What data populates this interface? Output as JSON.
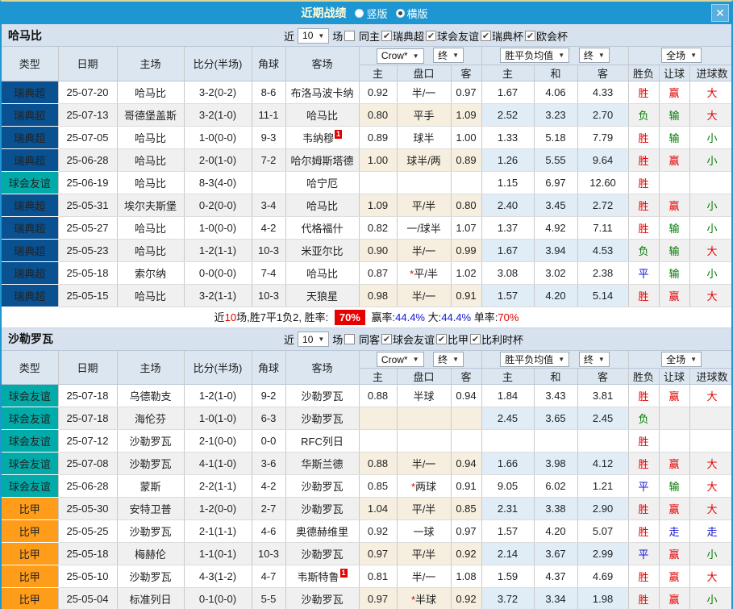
{
  "window": {
    "title": "近期战绩",
    "vertical_label": "竖版",
    "horizontal_label": "横版",
    "close_icon": "✕"
  },
  "columns": {
    "left": [
      "类型",
      "日期",
      "主场",
      "比分(半场)",
      "角球",
      "客场"
    ],
    "sub": [
      "主",
      "盘口",
      "客",
      "主",
      "和",
      "客",
      "胜负",
      "让球",
      "进球数"
    ],
    "dropdowns": {
      "company": "Crow*",
      "final": "终",
      "avg": "胜平负均值",
      "fulltime": "全场"
    }
  },
  "colors": {
    "type": {
      "瑞典超": "#0a5191",
      "球会友谊": "#00aba9",
      "比甲": "#ff9c1a"
    },
    "result": {
      "胜": "#e60000",
      "负": "#007a00",
      "平": "#1414d2",
      "赢": "#e60000",
      "输": "#007a00",
      "走": "#1414d2",
      "大": "#e60000",
      "小": "#007a00"
    }
  },
  "sections": [
    {
      "team": "哈马比",
      "filter": {
        "near_label": "近",
        "count": "10",
        "games_label": "场",
        "same_label": "同主",
        "same_checked": false,
        "leagues": [
          {
            "label": "瑞典超",
            "checked": true
          },
          {
            "label": "球会友谊",
            "checked": true
          },
          {
            "label": "瑞典杯",
            "checked": true
          },
          {
            "label": "欧会杯",
            "checked": true
          }
        ]
      },
      "rows": [
        {
          "type": "瑞典超",
          "date": "25-07-20",
          "home": "哈马比",
          "home_hl": true,
          "score": "3-2(0-2)",
          "corner": "8-6",
          "away": "布洛马波卡纳",
          "away_hl": false,
          "away_badge": "",
          "o1": "0.92",
          "hc": "半/一",
          "o2": "0.97",
          "a1": "1.67",
          "a2": "4.06",
          "a3": "4.33",
          "r1": "胜",
          "r2": "赢",
          "r3": "大"
        },
        {
          "type": "瑞典超",
          "date": "25-07-13",
          "home": "哥德堡盖斯",
          "home_hl": false,
          "score": "3-2(1-0)",
          "corner": "11-1",
          "away": "哈马比",
          "away_hl": true,
          "away_badge": "",
          "o1": "0.80",
          "hc": "平手",
          "o2": "1.09",
          "a1": "2.52",
          "a2": "3.23",
          "a3": "2.70",
          "r1": "负",
          "r2": "输",
          "r3": "大"
        },
        {
          "type": "瑞典超",
          "date": "25-07-05",
          "home": "哈马比",
          "home_hl": true,
          "score": "1-0(0-0)",
          "corner": "9-3",
          "away": "韦纳穆",
          "away_hl": false,
          "away_badge": "1",
          "o1": "0.89",
          "hc": "球半",
          "o2": "1.00",
          "a1": "1.33",
          "a2": "5.18",
          "a3": "7.79",
          "r1": "胜",
          "r2": "输",
          "r3": "小"
        },
        {
          "type": "瑞典超",
          "date": "25-06-28",
          "home": "哈马比",
          "home_hl": true,
          "score": "2-0(1-0)",
          "corner": "7-2",
          "away": "哈尔姆斯塔德",
          "away_hl": false,
          "away_badge": "",
          "o1": "1.00",
          "hc": "球半/两",
          "o2": "0.89",
          "a1": "1.26",
          "a2": "5.55",
          "a3": "9.64",
          "r1": "胜",
          "r2": "赢",
          "r3": "小"
        },
        {
          "type": "球会友谊",
          "date": "25-06-19",
          "home": "哈马比",
          "home_hl": true,
          "score": "8-3(4-0)",
          "corner": "",
          "away": "哈宁厄",
          "away_hl": false,
          "away_badge": "",
          "o1": "",
          "hc": "",
          "o2": "",
          "a1": "1.15",
          "a2": "6.97",
          "a3": "12.60",
          "r1": "胜",
          "r2": "",
          "r3": ""
        },
        {
          "type": "瑞典超",
          "date": "25-05-31",
          "home": "埃尔夫斯堡",
          "home_hl": false,
          "score": "0-2(0-0)",
          "corner": "3-4",
          "away": "哈马比",
          "away_hl": true,
          "away_badge": "",
          "o1": "1.09",
          "hc": "平/半",
          "o2": "0.80",
          "a1": "2.40",
          "a2": "3.45",
          "a3": "2.72",
          "r1": "胜",
          "r2": "赢",
          "r3": "小"
        },
        {
          "type": "瑞典超",
          "date": "25-05-27",
          "home": "哈马比",
          "home_hl": true,
          "score": "1-0(0-0)",
          "corner": "4-2",
          "away": "代格福什",
          "away_hl": false,
          "away_badge": "",
          "o1": "0.82",
          "hc": "一/球半",
          "o2": "1.07",
          "a1": "1.37",
          "a2": "4.92",
          "a3": "7.11",
          "r1": "胜",
          "r2": "输",
          "r3": "小"
        },
        {
          "type": "瑞典超",
          "date": "25-05-23",
          "home": "哈马比",
          "home_hl": true,
          "score": "1-2(1-1)",
          "corner": "10-3",
          "away": "米亚尔比",
          "away_hl": false,
          "away_badge": "",
          "o1": "0.90",
          "hc": "半/一",
          "o2": "0.99",
          "a1": "1.67",
          "a2": "3.94",
          "a3": "4.53",
          "r1": "负",
          "r2": "输",
          "r3": "大"
        },
        {
          "type": "瑞典超",
          "date": "25-05-18",
          "home": "索尔纳",
          "home_hl": false,
          "score": "0-0(0-0)",
          "corner": "7-4",
          "away": "哈马比",
          "away_hl": true,
          "away_badge": "",
          "o1": "0.87",
          "hc": "*平/半",
          "o2": "1.02",
          "a1": "3.08",
          "a2": "3.02",
          "a3": "2.38",
          "r1": "平",
          "r2": "输",
          "r3": "小"
        },
        {
          "type": "瑞典超",
          "date": "25-05-15",
          "home": "哈马比",
          "home_hl": true,
          "score": "3-2(1-1)",
          "corner": "10-3",
          "away": "天狼星",
          "away_hl": false,
          "away_badge": "",
          "o1": "0.98",
          "hc": "半/一",
          "o2": "0.91",
          "a1": "1.57",
          "a2": "4.20",
          "a3": "5.14",
          "r1": "胜",
          "r2": "赢",
          "r3": "大"
        }
      ],
      "summary": {
        "prefix": "近",
        "count": "10",
        "record": "场,胜7平1负2, 胜率:",
        "win_rate": "70%",
        "profit_label": "赢率:",
        "profit_value": "44.4%",
        "big_label": "大:",
        "big_value": "44.4%",
        "single_label": "单率:",
        "single_value": "70%"
      }
    },
    {
      "team": "沙勒罗瓦",
      "filter": {
        "near_label": "近",
        "count": "10",
        "games_label": "场",
        "same_label": "同客",
        "same_checked": false,
        "leagues": [
          {
            "label": "球会友谊",
            "checked": true
          },
          {
            "label": "比甲",
            "checked": true
          },
          {
            "label": "比利时杯",
            "checked": true
          }
        ]
      },
      "rows": [
        {
          "type": "球会友谊",
          "date": "25-07-18",
          "home": "乌德勒支",
          "home_hl": false,
          "score": "1-2(1-0)",
          "corner": "9-2",
          "away": "沙勒罗瓦",
          "away_hl": true,
          "away_badge": "",
          "o1": "0.88",
          "hc": "半球",
          "o2": "0.94",
          "a1": "1.84",
          "a2": "3.43",
          "a3": "3.81",
          "r1": "胜",
          "r2": "赢",
          "r3": "大"
        },
        {
          "type": "球会友谊",
          "date": "25-07-18",
          "home": "海伦芬",
          "home_hl": false,
          "score": "1-0(1-0)",
          "corner": "6-3",
          "away": "沙勒罗瓦",
          "away_hl": true,
          "away_badge": "",
          "o1": "",
          "hc": "",
          "o2": "",
          "a1": "2.45",
          "a2": "3.65",
          "a3": "2.45",
          "r1": "负",
          "r2": "",
          "r3": ""
        },
        {
          "type": "球会友谊",
          "date": "25-07-12",
          "home": "沙勒罗瓦",
          "home_hl": true,
          "score": "2-1(0-0)",
          "corner": "0-0",
          "away": "RFC列日",
          "away_hl": false,
          "away_badge": "",
          "o1": "",
          "hc": "",
          "o2": "",
          "a1": "",
          "a2": "",
          "a3": "",
          "r1": "胜",
          "r2": "",
          "r3": ""
        },
        {
          "type": "球会友谊",
          "date": "25-07-08",
          "home": "沙勒罗瓦",
          "home_hl": true,
          "score": "4-1(1-0)",
          "corner": "3-6",
          "away": "华斯兰德",
          "away_hl": false,
          "away_badge": "",
          "o1": "0.88",
          "hc": "半/一",
          "o2": "0.94",
          "a1": "1.66",
          "a2": "3.98",
          "a3": "4.12",
          "r1": "胜",
          "r2": "赢",
          "r3": "大"
        },
        {
          "type": "球会友谊",
          "date": "25-06-28",
          "home": "蒙斯",
          "home_hl": false,
          "score": "2-2(1-1)",
          "corner": "4-2",
          "away": "沙勒罗瓦",
          "away_hl": true,
          "away_badge": "",
          "o1": "0.85",
          "hc": "*两球",
          "o2": "0.91",
          "a1": "9.05",
          "a2": "6.02",
          "a3": "1.21",
          "r1": "平",
          "r2": "输",
          "r3": "大"
        },
        {
          "type": "比甲",
          "date": "25-05-30",
          "home": "安特卫普",
          "home_hl": false,
          "score": "1-2(0-0)",
          "corner": "2-7",
          "away": "沙勒罗瓦",
          "away_hl": true,
          "away_badge": "",
          "o1": "1.04",
          "hc": "平/半",
          "o2": "0.85",
          "a1": "2.31",
          "a2": "3.38",
          "a3": "2.90",
          "r1": "胜",
          "r2": "赢",
          "r3": "大"
        },
        {
          "type": "比甲",
          "date": "25-05-25",
          "home": "沙勒罗瓦",
          "home_hl": true,
          "score": "2-1(1-1)",
          "corner": "4-6",
          "away": "奥德赫维里",
          "away_hl": false,
          "away_badge": "",
          "o1": "0.92",
          "hc": "一球",
          "o2": "0.97",
          "a1": "1.57",
          "a2": "4.20",
          "a3": "5.07",
          "r1": "胜",
          "r2": "走",
          "r3": "走"
        },
        {
          "type": "比甲",
          "date": "25-05-18",
          "home": "梅赫伦",
          "home_hl": false,
          "score": "1-1(0-1)",
          "corner": "10-3",
          "away": "沙勒罗瓦",
          "away_hl": true,
          "away_badge": "",
          "o1": "0.97",
          "hc": "平/半",
          "o2": "0.92",
          "a1": "2.14",
          "a2": "3.67",
          "a3": "2.99",
          "r1": "平",
          "r2": "赢",
          "r3": "小"
        },
        {
          "type": "比甲",
          "date": "25-05-10",
          "home": "沙勒罗瓦",
          "home_hl": true,
          "score": "4-3(1-2)",
          "corner": "4-7",
          "away": "韦斯特鲁",
          "away_hl": false,
          "away_badge": "1",
          "o1": "0.81",
          "hc": "半/一",
          "o2": "1.08",
          "a1": "1.59",
          "a2": "4.37",
          "a3": "4.69",
          "r1": "胜",
          "r2": "赢",
          "r3": "大"
        },
        {
          "type": "比甲",
          "date": "25-05-04",
          "home": "标准列日",
          "home_hl": false,
          "score": "0-1(0-0)",
          "corner": "5-5",
          "away": "沙勒罗瓦",
          "away_hl": true,
          "away_badge": "",
          "o1": "0.97",
          "hc": "*半球",
          "o2": "0.92",
          "a1": "3.72",
          "a2": "3.34",
          "a3": "1.98",
          "r1": "胜",
          "r2": "赢",
          "r3": "小"
        }
      ]
    }
  ]
}
